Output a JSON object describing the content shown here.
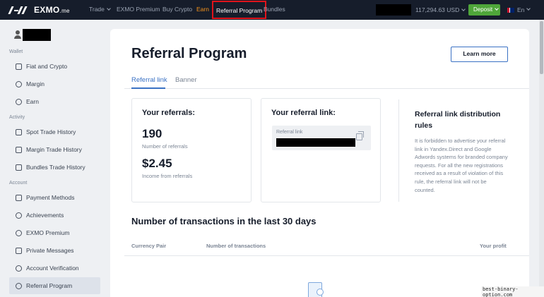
{
  "topbar": {
    "logo_text": "EXMO",
    "logo_suffix": ".me",
    "nav": [
      {
        "label": "Trade",
        "has_dropdown": true
      },
      {
        "label": "EXMO Premium"
      },
      {
        "label": "Buy Crypto"
      },
      {
        "label": "Earn"
      },
      {
        "label": "Referral Program"
      },
      {
        "label": "Bundles"
      }
    ],
    "balance": "117,294.63 USD",
    "deposit_label": "Deposit",
    "language": "En"
  },
  "sidebar": {
    "sections": [
      {
        "label": "Wallet"
      },
      {
        "label": "Activity"
      },
      {
        "label": "Account"
      }
    ],
    "items": [
      {
        "label": "Fiat and Crypto",
        "icon": "wallet-icon"
      },
      {
        "label": "Margin",
        "icon": "percent-icon"
      },
      {
        "label": "Earn",
        "icon": "coins-icon"
      },
      {
        "label": "Spot Trade History",
        "icon": "history-icon"
      },
      {
        "label": "Margin Trade History",
        "icon": "history-icon"
      },
      {
        "label": "Bundles Trade History",
        "icon": "history-icon"
      },
      {
        "label": "Payment Methods",
        "icon": "bank-icon"
      },
      {
        "label": "Achievements",
        "icon": "medal-icon"
      },
      {
        "label": "EXMO Premium",
        "icon": "premium-icon"
      },
      {
        "label": "Private Messages",
        "icon": "message-icon"
      },
      {
        "label": "Account Verification",
        "icon": "check-circle-icon"
      },
      {
        "label": "Referral Program",
        "icon": "referral-icon",
        "active": true
      }
    ]
  },
  "main": {
    "title": "Referral Program",
    "learn_more": "Learn more",
    "tabs": [
      {
        "label": "Referral link",
        "active": true
      },
      {
        "label": "Banner"
      }
    ],
    "referrals": {
      "title": "Your referrals:",
      "count": "190",
      "count_label": "Number of referrals",
      "income": "$2.45",
      "income_label": "Income from referrals"
    },
    "link": {
      "title": "Your referral link:",
      "field_label": "Referral link"
    },
    "rules": {
      "title": "Referral link distribution rules",
      "text": "It is forbidden to advertise your referral link in Yandex.Direct and Google Adwords systems for branded company requests. For all the new registrations received as a result of violation of this rule, the referral link will not be counted."
    },
    "transactions": {
      "title": "Number of transactions in the last 30 days",
      "columns": [
        "Currency Pair",
        "Number of transactions",
        "Your profit"
      ]
    }
  },
  "watermark": "best-binary-option.com",
  "colors": {
    "accent": "#3b72c4",
    "deposit": "#4fa63a",
    "earn": "#f7931a",
    "topbar": "#161d2b"
  }
}
